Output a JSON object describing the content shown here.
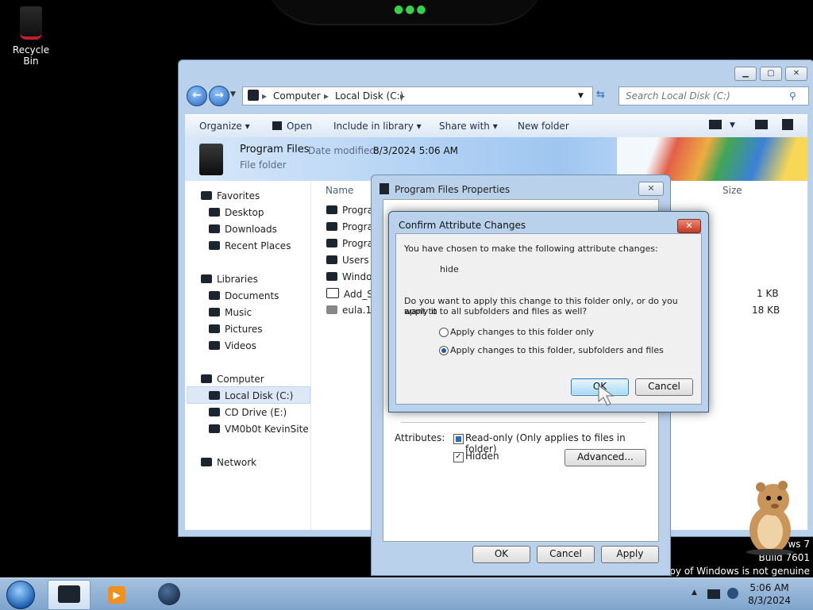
{
  "desktop": {
    "recycle_bin_label": "Recycle Bin",
    "watermark": [
      "ws 7",
      "Build 7601",
      "s copy of Windows is not genuine"
    ]
  },
  "explorer": {
    "breadcrumb": [
      "Computer",
      "Local Disk (C:)"
    ],
    "search_placeholder": "Search Local Disk (C:)",
    "toolbar": {
      "organize": "Organize",
      "open": "Open",
      "include_in_library": "Include in library",
      "share_with": "Share with",
      "new_folder": "New folder"
    },
    "details": {
      "name": "Program Files",
      "modified_label": "Date modified:",
      "modified_value": "8/3/2024 5:06 AM",
      "type": "File folder"
    },
    "columns": {
      "name": "Name",
      "size": "Size"
    },
    "nav": {
      "favorites": "Favorites",
      "desktop": "Desktop",
      "downloads": "Downloads",
      "recent_places": "Recent Places",
      "libraries": "Libraries",
      "documents": "Documents",
      "music": "Music",
      "pictures": "Pictures",
      "videos": "Videos",
      "computer": "Computer",
      "local_disk": "Local Disk (C:)",
      "cd_drive": "CD Drive (E:)",
      "vmshare": "VM0b0t KevinSite",
      "network": "Network"
    },
    "files": [
      {
        "name": "Progran",
        "size": ""
      },
      {
        "name": "Progran",
        "size": ""
      },
      {
        "name": "Progran",
        "size": ""
      },
      {
        "name": "Users",
        "size": ""
      },
      {
        "name": "Windo",
        "size": ""
      },
      {
        "name": "Add_Sh",
        "size": "1 KB"
      },
      {
        "name": "eula.10",
        "size": "18 KB"
      }
    ]
  },
  "properties": {
    "title": "Program Files Properties",
    "attributes_label": "Attributes:",
    "readonly_label": "Read-only (Only applies to files in folder)",
    "hidden_label": "Hidden",
    "advanced_button": "Advanced...",
    "ok": "OK",
    "cancel": "Cancel",
    "apply": "Apply"
  },
  "confirm": {
    "title": "Confirm Attribute Changes",
    "intro": "You have chosen to make the following attribute changes:",
    "change": "hide",
    "question_line1": "Do you want to apply this change to this folder only, or do you want to",
    "question_line2": "apply it to all subfolders and files as well?",
    "option_folder_only": "Apply changes to this folder only",
    "option_all": "Apply changes to this folder, subfolders and files",
    "selected_option": "all",
    "ok": "OK",
    "cancel": "Cancel"
  },
  "taskbar": {
    "time": "5:06 AM",
    "date": "8/3/2024"
  },
  "icons": [
    "recycle-bin-icon",
    "back-arrow-icon",
    "forward-arrow-icon",
    "search-icon",
    "folder-icon",
    "start-orb-icon",
    "network-tray-icon"
  ]
}
